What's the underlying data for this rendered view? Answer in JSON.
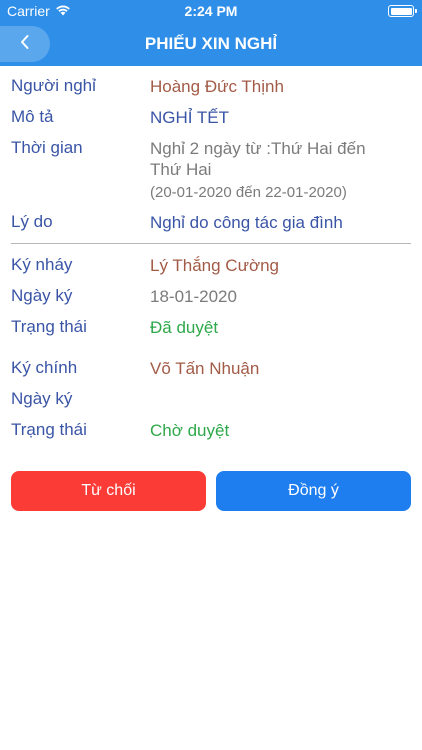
{
  "status": {
    "carrier": "Carrier",
    "time": "2:24 PM"
  },
  "nav": {
    "title": "PHIẾU XIN NGHỈ"
  },
  "form": {
    "requester": {
      "label": "Người nghỉ",
      "value": "Hoàng Đức Thịnh"
    },
    "description": {
      "label": "Mô tả",
      "value": "NGHỈ TẾT"
    },
    "time": {
      "label": "Thời gian",
      "line1": "Nghỉ 2 ngày từ :Thứ Hai đến",
      "line2": "Thứ Hai",
      "range": "(20-01-2020 đến 22-01-2020)"
    },
    "reason": {
      "label": "Lý do",
      "value": "Nghỉ do công tác gia đình"
    }
  },
  "initial_sign": {
    "signer": {
      "label": "Ký nháy",
      "value": "Lý Thắng Cường"
    },
    "date": {
      "label": "Ngày ký",
      "value": "18-01-2020"
    },
    "status": {
      "label": "Trạng thái",
      "value": "Đã duyệt"
    }
  },
  "main_sign": {
    "signer": {
      "label": "Ký chính",
      "value": "Võ Tấn Nhuận"
    },
    "date": {
      "label": "Ngày ký",
      "value": ""
    },
    "status": {
      "label": "Trạng thái",
      "value": "Chờ duyệt"
    }
  },
  "actions": {
    "reject": "Từ chối",
    "accept": "Đồng ý"
  },
  "colors": {
    "primary": "#2e8ee8",
    "reject": "#fb3b36",
    "accept": "#1e7ef0",
    "label": "#3a55a6",
    "name": "#a25b46",
    "approved": "#2ea84a"
  }
}
